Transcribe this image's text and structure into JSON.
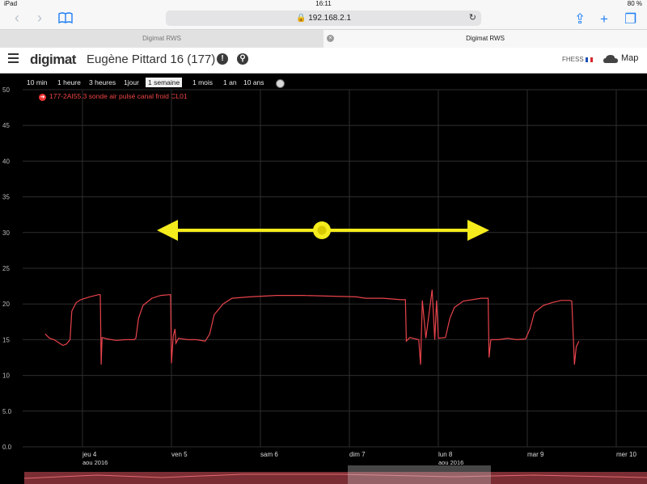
{
  "status_bar": {
    "device": "iPad",
    "time": "16:11",
    "battery": "80 %"
  },
  "browser": {
    "url": "192.168.2.1",
    "tabs": [
      "Digimat RWS",
      "Digimat RWS"
    ]
  },
  "app": {
    "logo": "digimat",
    "title": "Eugène Pittard 16 (177)",
    "user": "FHESS",
    "map_label": "Map"
  },
  "ranges": [
    "10 min",
    "1 heure",
    "3 heures",
    "1jour",
    "1 semaine",
    "1 mois",
    "1 an",
    "10 ans"
  ],
  "active_range": "1 semaine",
  "colors": {
    "series": "#e8434b",
    "annotation": "#f4ec1c",
    "grid": "#2e2e2e",
    "navigator": "#7a2d33"
  },
  "chart_data": {
    "type": "line",
    "series": [
      {
        "name": "177-2AI55.3   sonde air pulsé canal froid CL01",
        "points": [
          [
            0.0,
            15.8
          ],
          [
            0.05,
            15.2
          ],
          [
            0.1,
            15.0
          ],
          [
            0.15,
            14.6
          ],
          [
            0.2,
            14.2
          ],
          [
            0.24,
            14.4
          ],
          [
            0.28,
            15.0
          ],
          [
            0.3,
            19.0
          ],
          [
            0.35,
            20.2
          ],
          [
            0.4,
            20.6
          ],
          [
            0.5,
            21.0
          ],
          [
            0.6,
            21.3
          ],
          [
            0.62,
            21.3
          ],
          [
            0.63,
            11.5
          ],
          [
            0.64,
            15.3
          ],
          [
            0.7,
            15.1
          ],
          [
            0.8,
            14.9
          ],
          [
            0.9,
            15.0
          ],
          [
            1.0,
            15.0
          ],
          [
            1.02,
            15.2
          ],
          [
            1.05,
            18.0
          ],
          [
            1.1,
            19.8
          ],
          [
            1.2,
            20.8
          ],
          [
            1.3,
            21.2
          ],
          [
            1.4,
            21.3
          ],
          [
            1.41,
            21.3
          ],
          [
            1.42,
            11.7
          ],
          [
            1.44,
            15.5
          ],
          [
            1.46,
            16.5
          ],
          [
            1.47,
            14.5
          ],
          [
            1.5,
            15.2
          ],
          [
            1.6,
            15.0
          ],
          [
            1.7,
            15.0
          ],
          [
            1.8,
            14.8
          ],
          [
            1.85,
            15.8
          ],
          [
            1.9,
            18.5
          ],
          [
            2.0,
            20.0
          ],
          [
            2.1,
            20.8
          ],
          [
            2.3,
            21.0
          ],
          [
            2.6,
            21.2
          ],
          [
            2.9,
            21.2
          ],
          [
            3.2,
            21.1
          ],
          [
            3.5,
            21.0
          ],
          [
            3.6,
            20.8
          ],
          [
            3.8,
            20.8
          ],
          [
            4.0,
            20.6
          ],
          [
            4.05,
            20.6
          ],
          [
            4.06,
            14.8
          ],
          [
            4.1,
            15.3
          ],
          [
            4.2,
            15.0
          ],
          [
            4.22,
            11.5
          ],
          [
            4.24,
            20.5
          ],
          [
            4.28,
            15.2
          ],
          [
            4.35,
            22.0
          ],
          [
            4.38,
            15.0
          ],
          [
            4.4,
            20.5
          ],
          [
            4.42,
            15.2
          ],
          [
            4.5,
            15.3
          ],
          [
            4.55,
            18.0
          ],
          [
            4.6,
            19.5
          ],
          [
            4.7,
            20.4
          ],
          [
            4.9,
            20.8
          ],
          [
            4.98,
            20.8
          ],
          [
            4.99,
            12.5
          ],
          [
            5.01,
            15.0
          ],
          [
            5.1,
            15.0
          ],
          [
            5.2,
            15.2
          ],
          [
            5.3,
            15.0
          ],
          [
            5.4,
            15.1
          ],
          [
            5.45,
            16.5
          ],
          [
            5.5,
            18.8
          ],
          [
            5.6,
            19.8
          ],
          [
            5.7,
            20.2
          ],
          [
            5.8,
            20.5
          ],
          [
            5.9,
            20.5
          ],
          [
            5.92,
            20.4
          ],
          [
            5.95,
            11.5
          ],
          [
            5.97,
            14.0
          ],
          [
            6.0,
            14.8
          ]
        ]
      }
    ],
    "y_ticks": [
      "0.0",
      "5.0",
      "10",
      "15",
      "20",
      "25",
      "30",
      "35",
      "40",
      "45",
      "50"
    ],
    "ylim": [
      0,
      50
    ],
    "x_ticks": [
      {
        "day": "jeu 4",
        "month": "aou 2016"
      },
      {
        "day": "ven 5",
        "month": ""
      },
      {
        "day": "sam 6",
        "month": ""
      },
      {
        "day": "dim 7",
        "month": ""
      },
      {
        "day": "lun 8",
        "month": "aou 2016"
      },
      {
        "day": "mar 9",
        "month": ""
      },
      {
        "day": "mer 10",
        "month": ""
      }
    ],
    "grid": true
  }
}
